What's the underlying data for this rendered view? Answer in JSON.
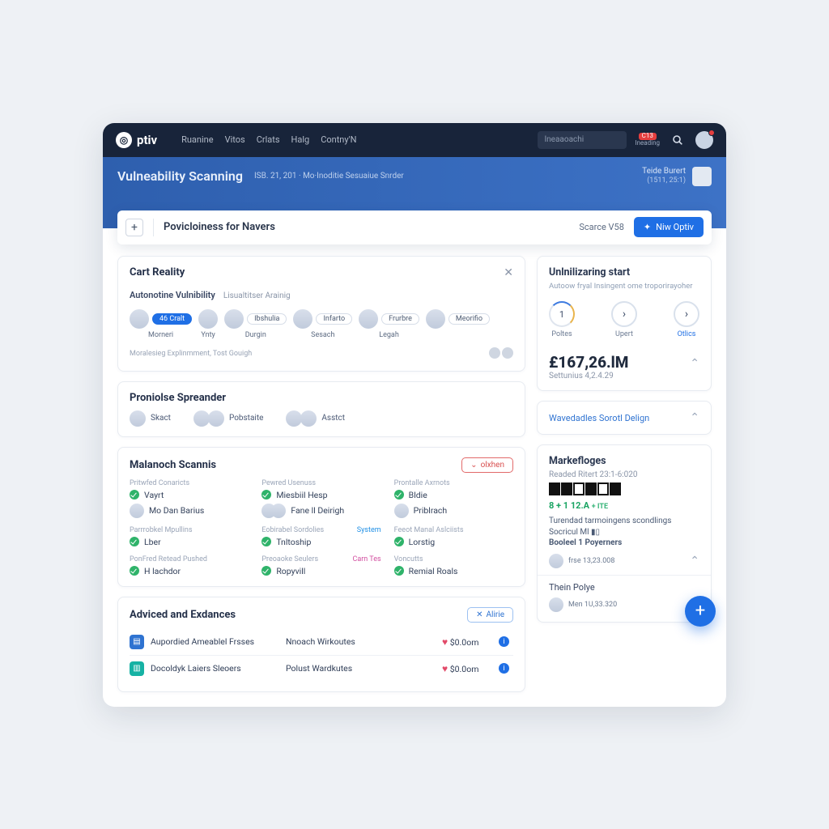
{
  "brand": "ptiv",
  "nav": [
    "Ruanine",
    "Vitos",
    "Crlats",
    "Halg",
    "Contny'N"
  ],
  "top": {
    "search_placeholder": "Ineaaoachi",
    "badge": "C13",
    "badge_label": "Ineading"
  },
  "subhead": {
    "title": "Vulneability Scanning",
    "crumb": "ISB. 21, 201 · Mo·Inoditie Sesuaiue Snrder",
    "user_name": "Teide Burert",
    "user_date": "(1511, 25:1)"
  },
  "bar": {
    "title": "Povicloiness for Navers",
    "link": "Scarce V58",
    "button": "Niw Optiv"
  },
  "cart": {
    "title": "Cart Reality",
    "subtitle": "Autonotine Vulnibility",
    "subtail": "Lisualtitser Arainig",
    "people": [
      {
        "pill": "46 Cralt",
        "pill_blue": true,
        "name": "Morneri"
      },
      {
        "pill": "",
        "name": "Ynty"
      },
      {
        "pill": "Ibshulia",
        "name": "Durgin"
      },
      {
        "pill": "Infarto",
        "name": "Sesach"
      },
      {
        "pill": "Frurbre",
        "name": "Legah"
      },
      {
        "pill": "Meorifio",
        "name": ""
      }
    ],
    "footer": "Moralesieg Explinmment, Tost Gouigh"
  },
  "spreader": {
    "title": "Proniolse Spreander",
    "items": [
      "Skact",
      "Pobstaite",
      "Asstct"
    ]
  },
  "scans": {
    "title": "Malanoch Scannis",
    "pill": "olxhen",
    "cols": [
      {
        "hdr": "Pritwfed Conaricts",
        "a": "Vayrt",
        "b": "Mo Dan Barius",
        "hdr2": "Parrrobkel Mpullins",
        "c": "Lber",
        "hdr3": "PonFred Retead Pushed",
        "d": "H lachdor"
      },
      {
        "hdr": "Pewred Usenuss",
        "a": "Miesbiil Hesp",
        "duo": true,
        "b": "Fane  ll Deirigh",
        "hdr2": "Eobirabel Sordolies",
        "c": "Tnltoship",
        "side": "System",
        "hdr3": "Preoaoke Seulers",
        "d": "Ropyvill",
        "side3": "Carn Tes",
        "side3pink": true
      },
      {
        "hdr": "Prontalle Axrnots",
        "a": "Bldie",
        "b": "Priblrach",
        "hdr2": "Feeot Manal Aslciists",
        "c": "Lorstig",
        "hdr3": "Voncutts",
        "d": "Remial Roals"
      }
    ]
  },
  "adviced": {
    "title": "Adviced and Exdances",
    "pill": "Alirie",
    "rows": [
      {
        "icon": "blue",
        "a": "Aupordied Ameablel Frsses",
        "b": "Nnoach Wirkoutes",
        "c": "$0.0om"
      },
      {
        "icon": "teal",
        "a": "Docoldyk Laiers Sleoers",
        "b": "Polust Wardkutes",
        "c": "$0.0om"
      }
    ]
  },
  "rside": {
    "start_title": "Unlnilizaring start",
    "start_sub": "Autoow fryal Insingent ome troporirayoher",
    "rings": [
      {
        "l": "Poltes",
        "v": "1"
      },
      {
        "l": "Upert",
        "v": "›"
      },
      {
        "l": "Otlics",
        "v": "›"
      }
    ],
    "big": "£167,26.lM",
    "big_sub": "Settunius 4,2.4.29",
    "link": "Wavedadles Sorotl Delign",
    "mk_title": "Markefloges",
    "mk_sub": "Readed Ritert 23:1-6:020",
    "mk_delta": "8 + 1 12.A",
    "mk_delta_tail": "+ ITE",
    "mk_text1": "Turendad tarmoingens scondlings Socricul Ml",
    "mk_text2": "Booleel 1 Poyerners",
    "mk_user1": "frse 13,23.008",
    "mk_sec": "Thein Polye",
    "mk_user2": "Men 1U,33.320"
  }
}
